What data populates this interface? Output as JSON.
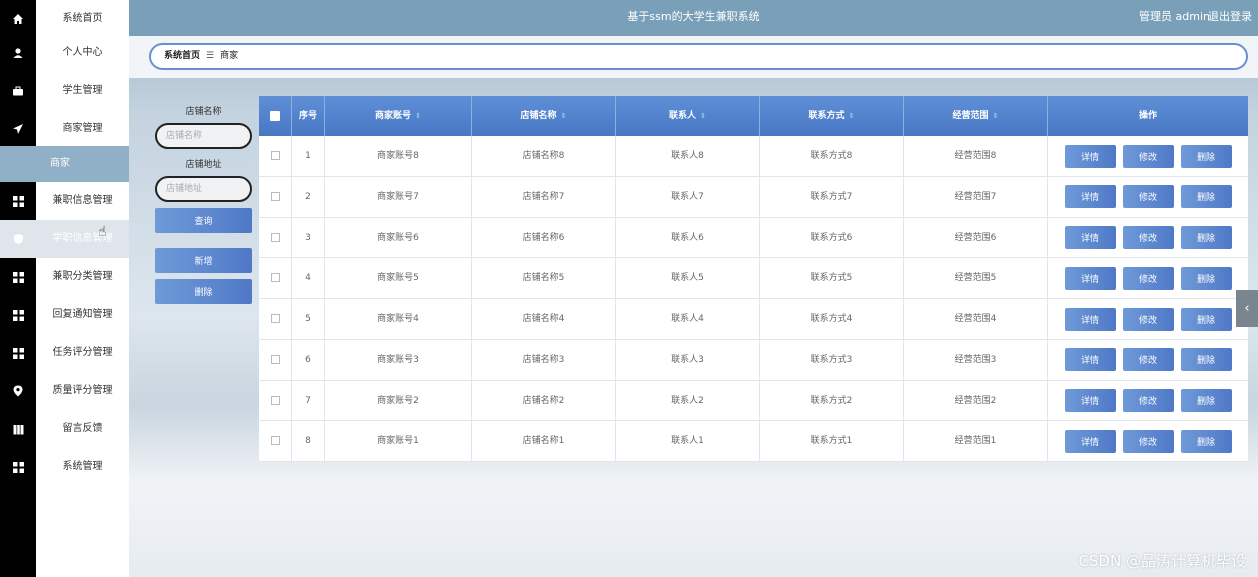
{
  "header": {
    "title": "基于ssm的大学生兼职系统",
    "user": "管理员 admin",
    "logout": "退出登录"
  },
  "breadcrumb": {
    "home": "系统首页",
    "separator": "☰",
    "current": "商家"
  },
  "sidebar": {
    "items": [
      {
        "label": "系统首页",
        "icon": "home-icon"
      },
      {
        "label": "个人中心",
        "icon": "user-icon"
      },
      {
        "label": "学生管理",
        "icon": "briefcase-icon"
      },
      {
        "label": "商家管理",
        "icon": "send-icon"
      },
      {
        "label": "兼职信息管理",
        "icon": "grid-icon"
      },
      {
        "label": "学职信息管理",
        "icon": "shield-icon"
      },
      {
        "label": "兼职分类管理",
        "icon": "grid-icon"
      },
      {
        "label": "回复通知管理",
        "icon": "grid-icon"
      },
      {
        "label": "任务评分管理",
        "icon": "grid-icon"
      },
      {
        "label": "质量评分管理",
        "icon": "pin-icon"
      },
      {
        "label": "留言反馈",
        "icon": "book-icon"
      },
      {
        "label": "系统管理",
        "icon": "grid-icon"
      }
    ],
    "sub_item": "商家"
  },
  "search": {
    "store_name_label": "店铺名称",
    "store_name_placeholder": "店铺名称",
    "store_addr_label": "店铺地址",
    "store_addr_placeholder": "店铺地址",
    "query_button": "查询",
    "add_button": "新增",
    "delete_button": "删除"
  },
  "table": {
    "headers": [
      "序号",
      "商家账号",
      "店铺名称",
      "联系人",
      "联系方式",
      "经营范围",
      "操作"
    ],
    "sort_glyph": "⇕",
    "rows": [
      {
        "no": "1",
        "account": "商家账号8",
        "store": "店铺名称8",
        "contact": "联系人8",
        "phone": "联系方式8",
        "scope": "经营范围8"
      },
      {
        "no": "2",
        "account": "商家账号7",
        "store": "店铺名称7",
        "contact": "联系人7",
        "phone": "联系方式7",
        "scope": "经营范围7"
      },
      {
        "no": "3",
        "account": "商家账号6",
        "store": "店铺名称6",
        "contact": "联系人6",
        "phone": "联系方式6",
        "scope": "经营范围6"
      },
      {
        "no": "4",
        "account": "商家账号5",
        "store": "店铺名称5",
        "contact": "联系人5",
        "phone": "联系方式5",
        "scope": "经营范围5"
      },
      {
        "no": "5",
        "account": "商家账号4",
        "store": "店铺名称4",
        "contact": "联系人4",
        "phone": "联系方式4",
        "scope": "经营范围4"
      },
      {
        "no": "6",
        "account": "商家账号3",
        "store": "店铺名称3",
        "contact": "联系人3",
        "phone": "联系方式3",
        "scope": "经营范围3"
      },
      {
        "no": "7",
        "account": "商家账号2",
        "store": "店铺名称2",
        "contact": "联系人2",
        "phone": "联系方式2",
        "scope": "经营范围2"
      },
      {
        "no": "8",
        "account": "商家账号1",
        "store": "店铺名称1",
        "contact": "联系人1",
        "phone": "联系方式1",
        "scope": "经营范围1"
      }
    ],
    "op_detail": "详情",
    "op_edit": "修改",
    "op_delete": "删除"
  },
  "collapse_tab": "‹",
  "watermark": "CSDN @晶涛计算机毕设",
  "colors": {
    "header_bg": "#7aa0b9",
    "accent": "#5a86cf",
    "sidebar_icon_bg": "#000000",
    "sub_item_bg": "#8fb0c6"
  }
}
